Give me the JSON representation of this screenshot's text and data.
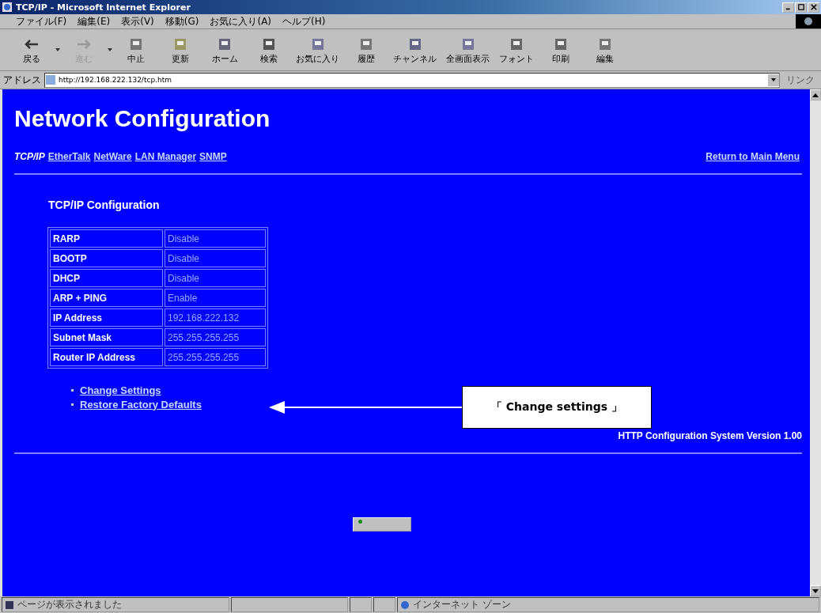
{
  "window": {
    "title": "TCP/IP - Microsoft Internet Explorer"
  },
  "menu": [
    "ファイル(F)",
    "編集(E)",
    "表示(V)",
    "移動(G)",
    "お気に入り(A)",
    "ヘルプ(H)"
  ],
  "toolbar": [
    {
      "label": "戻る",
      "disabled": false,
      "dropdown": true
    },
    {
      "label": "進む",
      "disabled": true,
      "dropdown": true
    },
    {
      "label": "中止",
      "disabled": false,
      "dropdown": false
    },
    {
      "label": "更新",
      "disabled": false,
      "dropdown": false
    },
    {
      "label": "ホーム",
      "disabled": false,
      "dropdown": false
    },
    {
      "label": "検索",
      "disabled": false,
      "dropdown": false
    },
    {
      "label": "お気に入り",
      "disabled": false,
      "dropdown": false
    },
    {
      "label": "履歴",
      "disabled": false,
      "dropdown": false
    },
    {
      "label": "チャンネル",
      "disabled": false,
      "dropdown": false
    },
    {
      "label": "全画面表示",
      "disabled": false,
      "dropdown": false
    },
    {
      "label": "フォント",
      "disabled": false,
      "dropdown": false
    },
    {
      "label": "印刷",
      "disabled": false,
      "dropdown": false
    },
    {
      "label": "編集",
      "disabled": false,
      "dropdown": false
    }
  ],
  "address_bar": {
    "label": "アドレス",
    "value": "http://192.168.222.132/tcp.htm",
    "links": "リンク"
  },
  "page": {
    "heading": "Network Configuration",
    "tabs": [
      {
        "label": "TCP/IP",
        "selected": true
      },
      {
        "label": "EtherTalk",
        "selected": false
      },
      {
        "label": "NetWare",
        "selected": false
      },
      {
        "label": "LAN Manager",
        "selected": false
      },
      {
        "label": "SNMP",
        "selected": false
      }
    ],
    "return_link": "Return to Main Menu",
    "section_title": "TCP/IP Configuration",
    "table": {
      "rows": [
        {
          "name": "RARP",
          "value": "Disable"
        },
        {
          "name": "BOOTP",
          "value": "Disable"
        },
        {
          "name": "DHCP",
          "value": "Disable"
        },
        {
          "name": "ARP + PING",
          "value": "Enable"
        },
        {
          "name": "IP Address",
          "value": "192.168.222.132"
        },
        {
          "name": "Subnet Mask",
          "value": "255.255.255.255"
        },
        {
          "name": "Router IP Address",
          "value": "255.255.255.255"
        }
      ]
    },
    "links": [
      "Change Settings",
      "Restore Factory Defaults"
    ],
    "version": "HTTP Configuration System Version 1.00"
  },
  "callout": {
    "text": "「 Change settings 」"
  },
  "status_bar": {
    "message": "ページが表示されました",
    "zone": "インターネット ゾーン"
  }
}
